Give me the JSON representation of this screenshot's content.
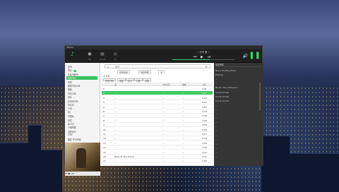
{
  "app": {
    "title": "Melon"
  },
  "topnav": [
    {
      "label": "",
      "icon": "music-note-icon"
    },
    {
      "label": "My",
      "icon": "person-icon"
    },
    {
      "label": "Chart",
      "icon": "chart-icon"
    },
    {
      "label": "DJ",
      "icon": "dj-icon"
    }
  ],
  "player": {
    "title": "~ 선곡 할 ~",
    "progress": 0.6,
    "controls": {
      "prev": "⏮",
      "play": "▶",
      "next": "⏭"
    }
  },
  "sidebar": {
    "items": [
      {
        "label": "검색",
        "active": false
      },
      {
        "label": "최신",
        "badge": "1",
        "active": false
      },
      {
        "label": "오늘의음악",
        "active": false
      },
      {
        "label": "플레이어",
        "active": true
      },
      {
        "label": "추천",
        "active": false
      },
      {
        "label": "플레이리스트",
        "active": false
      },
      {
        "label": "앨범",
        "active": false
      },
      {
        "label": "아티스트",
        "active": false
      },
      {
        "label": "장르",
        "active": false
      },
      {
        "label": "뮤직비디오",
        "active": false
      },
      {
        "label": "라디오",
        "active": false
      },
      {
        "label": "스타",
        "active": false
      },
      {
        "label": "DJ",
        "active": false
      },
      {
        "label": "이벤트",
        "active": false
      },
      {
        "label": "공연",
        "active": false
      },
      {
        "label": "로그인",
        "active": false
      },
      {
        "label": "구매목록",
        "active": false
      },
      {
        "label": "다운로드",
        "active": false
      },
      {
        "label": "TOP",
        "active": false
      },
      {
        "label": "멜론 프리미엄",
        "active": false
      }
    ],
    "mini_controls": "⏮ ▶ ⏭ ♡"
  },
  "search": {
    "value": "",
    "placeholder": "검색"
  },
  "tabs": [
    {
      "label": "현재재생",
      "active": false
    },
    {
      "label": "재생목록",
      "active": false
    },
    {
      "label": "곡",
      "active": true
    }
  ],
  "subtitle": "곡 목록",
  "toolbar": [
    "전체선택",
    "재생",
    "담기",
    "다운",
    "삭제"
  ],
  "table": {
    "headers": [
      "",
      "곡",
      "아티스트",
      "앨범",
      "시간"
    ],
    "rows": [
      {
        "num": "1",
        "title": "...",
        "artist": "...",
        "album": "...",
        "time": "3:41",
        "selected": false
      },
      {
        "num": "2",
        "title": "...",
        "artist": "...",
        "album": "...",
        "time": "3:12",
        "selected": true
      },
      {
        "num": "3",
        "title": "...",
        "artist": "...",
        "album": "...",
        "time": "4:02",
        "selected": false
      },
      {
        "num": "4",
        "title": "...",
        "artist": "...",
        "album": "...",
        "time": "3:27",
        "selected": false
      },
      {
        "num": "5",
        "title": "...",
        "artist": "...",
        "album": "...",
        "time": "3:55",
        "selected": false
      },
      {
        "num": "6",
        "title": "...",
        "artist": "...",
        "album": "...",
        "time": "4:18",
        "selected": false
      },
      {
        "num": "7",
        "title": "...",
        "artist": "...",
        "album": "...",
        "time": "3:08",
        "selected": false
      },
      {
        "num": "8",
        "title": "...",
        "artist": "...",
        "album": "...",
        "time": "3:49",
        "selected": false
      },
      {
        "num": "9",
        "title": "...",
        "artist": "...",
        "album": "...",
        "time": "3:33",
        "selected": false
      },
      {
        "num": "10",
        "title": "...",
        "artist": "...",
        "album": "...",
        "time": "4:05",
        "selected": false
      },
      {
        "num": "11",
        "title": "...",
        "artist": "...",
        "album": "...",
        "time": "3:17",
        "selected": false
      },
      {
        "num": "12",
        "title": "...",
        "artist": "...",
        "album": "...",
        "time": "3:44",
        "selected": false
      },
      {
        "num": "13",
        "title": "...",
        "artist": "...",
        "album": "...",
        "time": "3:59",
        "selected": false
      },
      {
        "num": "14",
        "title": "...",
        "artist": "...",
        "album": "...",
        "time": "3:22",
        "selected": false
      },
      {
        "num": "15",
        "title": "...",
        "artist": "...",
        "album": "...",
        "time": "4:11",
        "selected": false
      },
      {
        "num": "16",
        "title": "Back To The Future",
        "artist": "...",
        "album": "...",
        "time": "3:37",
        "selected": false
      },
      {
        "num": "17",
        "title": "...",
        "artist": "...",
        "album": "...",
        "time": "3:50",
        "selected": false
      }
    ]
  },
  "rpanel": {
    "title": "재생목록",
    "items": [
      {
        "label": "Never Ending Story",
        "active": false
      },
      {
        "label": "Darling",
        "active": false
      },
      {
        "label": "...",
        "active": false
      },
      {
        "label": "...",
        "active": false
      },
      {
        "label": "Be On The Champion",
        "active": false
      },
      {
        "label": "Circle Of Life",
        "active": false
      },
      {
        "label": "Circle Of Life",
        "active": false
      },
      {
        "label": "Circle Of Life",
        "active": false
      },
      {
        "label": "...",
        "active": false
      },
      {
        "label": "...",
        "active": false
      },
      {
        "label": "...",
        "active": false
      },
      {
        "label": "...",
        "active": false
      },
      {
        "label": "...",
        "active": false
      },
      {
        "label": "...",
        "active": false
      },
      {
        "label": "...",
        "active": false
      },
      {
        "label": "...",
        "active": false
      },
      {
        "label": "...",
        "active": false
      },
      {
        "label": "...",
        "active": false
      },
      {
        "label": "...",
        "active": false
      },
      {
        "label": "...",
        "active": false
      },
      {
        "label": "...",
        "active": false
      },
      {
        "label": "...",
        "active": true
      }
    ]
  }
}
